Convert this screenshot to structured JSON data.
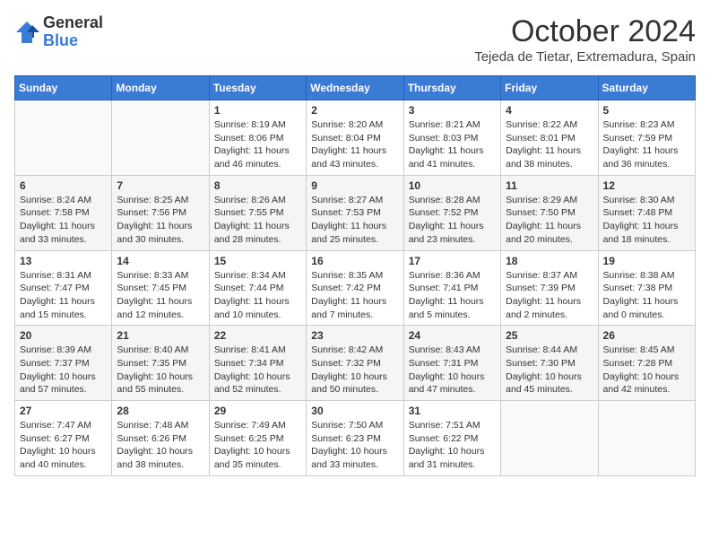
{
  "header": {
    "logo_line1": "General",
    "logo_line2": "Blue",
    "month": "October 2024",
    "location": "Tejeda de Tietar, Extremadura, Spain"
  },
  "weekdays": [
    "Sunday",
    "Monday",
    "Tuesday",
    "Wednesday",
    "Thursday",
    "Friday",
    "Saturday"
  ],
  "weeks": [
    [
      {
        "day": "",
        "info": ""
      },
      {
        "day": "",
        "info": ""
      },
      {
        "day": "1",
        "info": "Sunrise: 8:19 AM\nSunset: 8:06 PM\nDaylight: 11 hours and 46 minutes."
      },
      {
        "day": "2",
        "info": "Sunrise: 8:20 AM\nSunset: 8:04 PM\nDaylight: 11 hours and 43 minutes."
      },
      {
        "day": "3",
        "info": "Sunrise: 8:21 AM\nSunset: 8:03 PM\nDaylight: 11 hours and 41 minutes."
      },
      {
        "day": "4",
        "info": "Sunrise: 8:22 AM\nSunset: 8:01 PM\nDaylight: 11 hours and 38 minutes."
      },
      {
        "day": "5",
        "info": "Sunrise: 8:23 AM\nSunset: 7:59 PM\nDaylight: 11 hours and 36 minutes."
      }
    ],
    [
      {
        "day": "6",
        "info": "Sunrise: 8:24 AM\nSunset: 7:58 PM\nDaylight: 11 hours and 33 minutes."
      },
      {
        "day": "7",
        "info": "Sunrise: 8:25 AM\nSunset: 7:56 PM\nDaylight: 11 hours and 30 minutes."
      },
      {
        "day": "8",
        "info": "Sunrise: 8:26 AM\nSunset: 7:55 PM\nDaylight: 11 hours and 28 minutes."
      },
      {
        "day": "9",
        "info": "Sunrise: 8:27 AM\nSunset: 7:53 PM\nDaylight: 11 hours and 25 minutes."
      },
      {
        "day": "10",
        "info": "Sunrise: 8:28 AM\nSunset: 7:52 PM\nDaylight: 11 hours and 23 minutes."
      },
      {
        "day": "11",
        "info": "Sunrise: 8:29 AM\nSunset: 7:50 PM\nDaylight: 11 hours and 20 minutes."
      },
      {
        "day": "12",
        "info": "Sunrise: 8:30 AM\nSunset: 7:48 PM\nDaylight: 11 hours and 18 minutes."
      }
    ],
    [
      {
        "day": "13",
        "info": "Sunrise: 8:31 AM\nSunset: 7:47 PM\nDaylight: 11 hours and 15 minutes."
      },
      {
        "day": "14",
        "info": "Sunrise: 8:33 AM\nSunset: 7:45 PM\nDaylight: 11 hours and 12 minutes."
      },
      {
        "day": "15",
        "info": "Sunrise: 8:34 AM\nSunset: 7:44 PM\nDaylight: 11 hours and 10 minutes."
      },
      {
        "day": "16",
        "info": "Sunrise: 8:35 AM\nSunset: 7:42 PM\nDaylight: 11 hours and 7 minutes."
      },
      {
        "day": "17",
        "info": "Sunrise: 8:36 AM\nSunset: 7:41 PM\nDaylight: 11 hours and 5 minutes."
      },
      {
        "day": "18",
        "info": "Sunrise: 8:37 AM\nSunset: 7:39 PM\nDaylight: 11 hours and 2 minutes."
      },
      {
        "day": "19",
        "info": "Sunrise: 8:38 AM\nSunset: 7:38 PM\nDaylight: 11 hours and 0 minutes."
      }
    ],
    [
      {
        "day": "20",
        "info": "Sunrise: 8:39 AM\nSunset: 7:37 PM\nDaylight: 10 hours and 57 minutes."
      },
      {
        "day": "21",
        "info": "Sunrise: 8:40 AM\nSunset: 7:35 PM\nDaylight: 10 hours and 55 minutes."
      },
      {
        "day": "22",
        "info": "Sunrise: 8:41 AM\nSunset: 7:34 PM\nDaylight: 10 hours and 52 minutes."
      },
      {
        "day": "23",
        "info": "Sunrise: 8:42 AM\nSunset: 7:32 PM\nDaylight: 10 hours and 50 minutes."
      },
      {
        "day": "24",
        "info": "Sunrise: 8:43 AM\nSunset: 7:31 PM\nDaylight: 10 hours and 47 minutes."
      },
      {
        "day": "25",
        "info": "Sunrise: 8:44 AM\nSunset: 7:30 PM\nDaylight: 10 hours and 45 minutes."
      },
      {
        "day": "26",
        "info": "Sunrise: 8:45 AM\nSunset: 7:28 PM\nDaylight: 10 hours and 42 minutes."
      }
    ],
    [
      {
        "day": "27",
        "info": "Sunrise: 7:47 AM\nSunset: 6:27 PM\nDaylight: 10 hours and 40 minutes."
      },
      {
        "day": "28",
        "info": "Sunrise: 7:48 AM\nSunset: 6:26 PM\nDaylight: 10 hours and 38 minutes."
      },
      {
        "day": "29",
        "info": "Sunrise: 7:49 AM\nSunset: 6:25 PM\nDaylight: 10 hours and 35 minutes."
      },
      {
        "day": "30",
        "info": "Sunrise: 7:50 AM\nSunset: 6:23 PM\nDaylight: 10 hours and 33 minutes."
      },
      {
        "day": "31",
        "info": "Sunrise: 7:51 AM\nSunset: 6:22 PM\nDaylight: 10 hours and 31 minutes."
      },
      {
        "day": "",
        "info": ""
      },
      {
        "day": "",
        "info": ""
      }
    ]
  ]
}
